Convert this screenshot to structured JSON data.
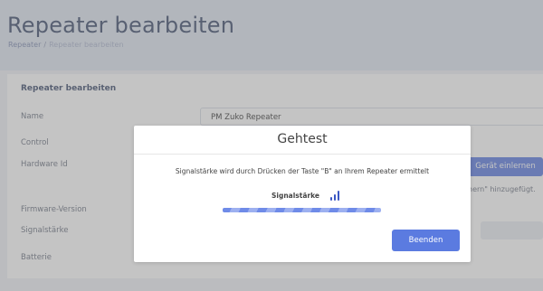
{
  "page": {
    "title": "Repeater bearbeiten",
    "breadcrumb": [
      "Repeater",
      "Repeater bearbeiten"
    ]
  },
  "panel": {
    "title": "Repeater bearbeiten",
    "fields": [
      {
        "label": "Name",
        "value": "PM Zuko Repeater"
      },
      {
        "label": "Control",
        "value": ""
      },
      {
        "label": "Hardware Id",
        "value": ""
      },
      {
        "label": "Firmware-Version",
        "value": ""
      },
      {
        "label": "Signalstärke",
        "value": ""
      },
      {
        "label": "Batterie",
        "value": ""
      }
    ],
    "learn_button": "Gerät einlernen",
    "right_note": "hern\" hinzugefügt."
  },
  "modal": {
    "title": "Gehtest",
    "text": "Signalstärke wird durch Drücken der Taste \"B\" an Ihrem Repeater ermittelt",
    "signal_label": "Signalstärke",
    "signal_bars": 3,
    "signal_icon": "signal-bars-icon",
    "progress_fraction": 1.0,
    "finish_button": "Beenden"
  },
  "colors": {
    "accent": "#5b7be0",
    "title": "#3b4a6b",
    "overlay": "rgba(125,125,125,0.45)"
  }
}
